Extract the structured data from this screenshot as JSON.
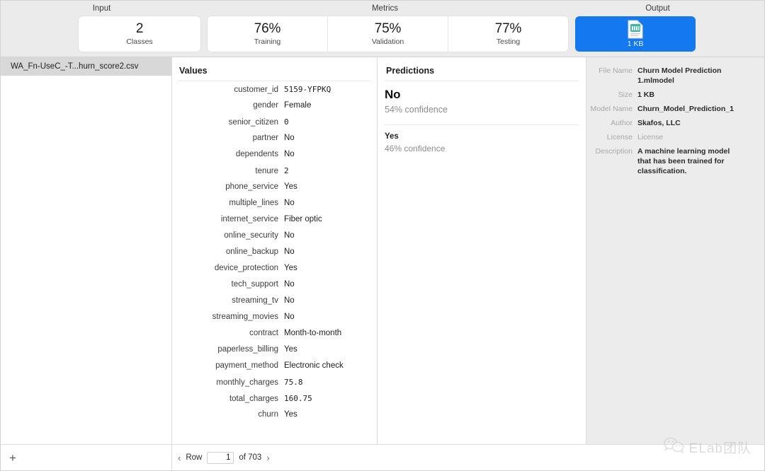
{
  "header": {
    "groups": [
      {
        "label": "Input"
      },
      {
        "label": "Metrics"
      },
      {
        "label": "Output"
      }
    ],
    "input_card": {
      "value": "2",
      "label": "Classes"
    },
    "metric_cards": [
      {
        "value": "76%",
        "label": "Training"
      },
      {
        "value": "75%",
        "label": "Validation"
      },
      {
        "value": "77%",
        "label": "Testing"
      }
    ],
    "output_card": {
      "icon": "mlmodel-file-icon",
      "label": "1 KB",
      "accent": "#1479ef"
    }
  },
  "sidebar": {
    "files": [
      {
        "name": "WA_Fn-UseC_-T...hurn_score2.csv",
        "selected": true
      }
    ],
    "add_button": "+"
  },
  "values": {
    "title": "Values",
    "rows": [
      {
        "key": "customer_id",
        "value": "5159-YFPKQ",
        "mono": true
      },
      {
        "key": "gender",
        "value": "Female",
        "mono": false
      },
      {
        "key": "senior_citizen",
        "value": "0",
        "mono": true
      },
      {
        "key": "partner",
        "value": "No",
        "mono": false
      },
      {
        "key": "dependents",
        "value": "No",
        "mono": false
      },
      {
        "key": "tenure",
        "value": "2",
        "mono": true
      },
      {
        "key": "phone_service",
        "value": "Yes",
        "mono": false
      },
      {
        "key": "multiple_lines",
        "value": "No",
        "mono": false
      },
      {
        "key": "internet_service",
        "value": "Fiber optic",
        "mono": false
      },
      {
        "key": "online_security",
        "value": "No",
        "mono": false
      },
      {
        "key": "online_backup",
        "value": "No",
        "mono": false
      },
      {
        "key": "device_protection",
        "value": "Yes",
        "mono": false
      },
      {
        "key": "tech_support",
        "value": "No",
        "mono": false
      },
      {
        "key": "streaming_tv",
        "value": "No",
        "mono": false
      },
      {
        "key": "streaming_movies",
        "value": "No",
        "mono": false
      },
      {
        "key": "contract",
        "value": "Month-to-month",
        "mono": false
      },
      {
        "key": "paperless_billing",
        "value": "Yes",
        "mono": false
      },
      {
        "key": "payment_method",
        "value": "Electronic check",
        "mono": false
      },
      {
        "key": "monthly_charges",
        "value": "75.8",
        "mono": true
      },
      {
        "key": "total_charges",
        "value": "160.75",
        "mono": true
      },
      {
        "key": "churn",
        "value": "Yes",
        "mono": false
      }
    ]
  },
  "predictions": {
    "title": "Predictions",
    "primary": {
      "label": "No",
      "confidence": "54% confidence"
    },
    "secondary": {
      "label": "Yes",
      "confidence": "46% confidence"
    }
  },
  "inspector": {
    "rows": [
      {
        "key": "File Name",
        "value": "Churn Model Prediction 1.mlmodel",
        "muted": false
      },
      {
        "key": "Size",
        "value": "1 KB",
        "muted": false
      },
      {
        "key": "Model Name",
        "value": "Churn_Model_Prediction_1",
        "muted": false
      },
      {
        "key": "Author",
        "value": "Skafos, LLC",
        "muted": false
      },
      {
        "key": "License",
        "value": "License",
        "muted": true
      },
      {
        "key": "Description",
        "value": "A machine learning model that has been trained for classification.",
        "muted": false
      }
    ]
  },
  "footer": {
    "prev_icon": "chevron-left-icon",
    "row_label": "Row",
    "row_value": "1",
    "of_label": "of 703",
    "next_icon": "chevron-right-icon"
  },
  "watermark": {
    "text": "ELab团队",
    "icon": "wechat-icon"
  }
}
